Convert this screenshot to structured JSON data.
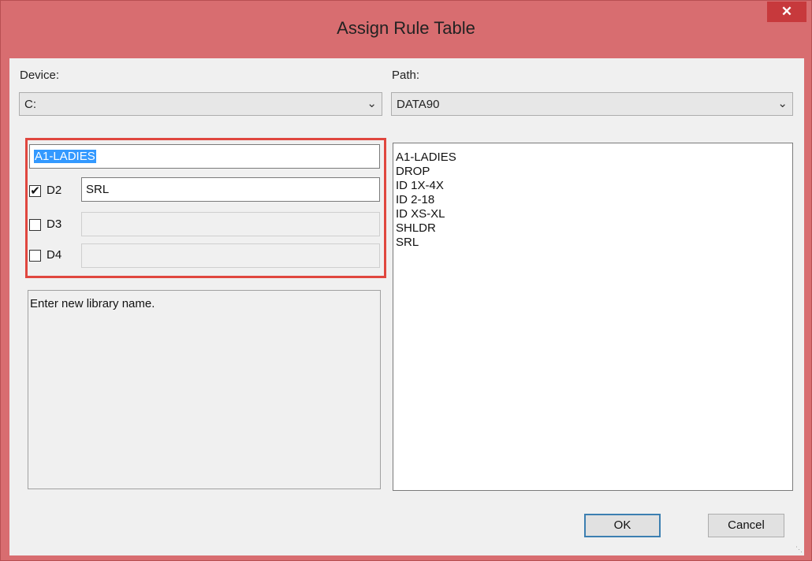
{
  "window": {
    "title": "Assign Rule Table",
    "close_label": "✕"
  },
  "device": {
    "label": "Device:",
    "value": "C:"
  },
  "path": {
    "label": "Path:",
    "value": "DATA90"
  },
  "library_name": {
    "value": "A1-LADIES"
  },
  "rules": [
    {
      "label": "D2",
      "checked": true,
      "value": "SRL"
    },
    {
      "label": "D3",
      "checked": false,
      "value": ""
    },
    {
      "label": "D4",
      "checked": false,
      "value": ""
    }
  ],
  "status": {
    "text": "Enter new library name."
  },
  "libraries": [
    "A1-LADIES",
    "DROP",
    "ID 1X-4X",
    "ID 2-18",
    "ID XS-XL",
    "SHLDR",
    "SRL"
  ],
  "buttons": {
    "ok": "OK",
    "cancel": "Cancel"
  },
  "colors": {
    "title_bar": "#d86d70",
    "close": "#c7393c",
    "highlight": "#e0473f",
    "selection": "#3399ff"
  },
  "icons": {
    "close": "close-icon",
    "dropdown": "chevron-down-icon",
    "check": "checkmark-icon"
  }
}
